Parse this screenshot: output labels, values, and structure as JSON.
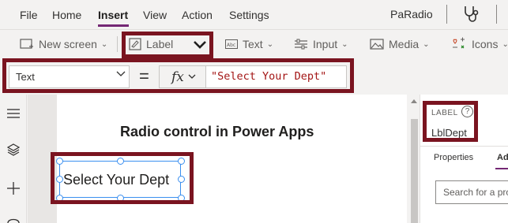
{
  "menubar": {
    "items": [
      {
        "label": "File"
      },
      {
        "label": "Home"
      },
      {
        "label": "Insert",
        "active": true
      },
      {
        "label": "View"
      },
      {
        "label": "Action"
      },
      {
        "label": "Settings"
      }
    ],
    "app_name": "PaRadio"
  },
  "toolbar": {
    "new_screen": "New screen",
    "label": "Label",
    "text": "Text",
    "input": "Input",
    "media": "Media",
    "icons": "Icons"
  },
  "formula_bar": {
    "property": "Text",
    "equals": "=",
    "fx": "fx",
    "formula": "\"Select Your Dept\""
  },
  "canvas": {
    "title": "Radio control in Power Apps",
    "label_text": "Select Your Dept"
  },
  "right_panel": {
    "control_type": "LABEL",
    "help": "?",
    "control_name": "LblDept",
    "tabs": [
      "Properties",
      "Ad"
    ],
    "search_placeholder": "Search for a pro"
  },
  "colors": {
    "accent": "#742774",
    "highlight": "#7a1420",
    "selection": "#3a8ff0",
    "formula_string": "#a31515"
  }
}
